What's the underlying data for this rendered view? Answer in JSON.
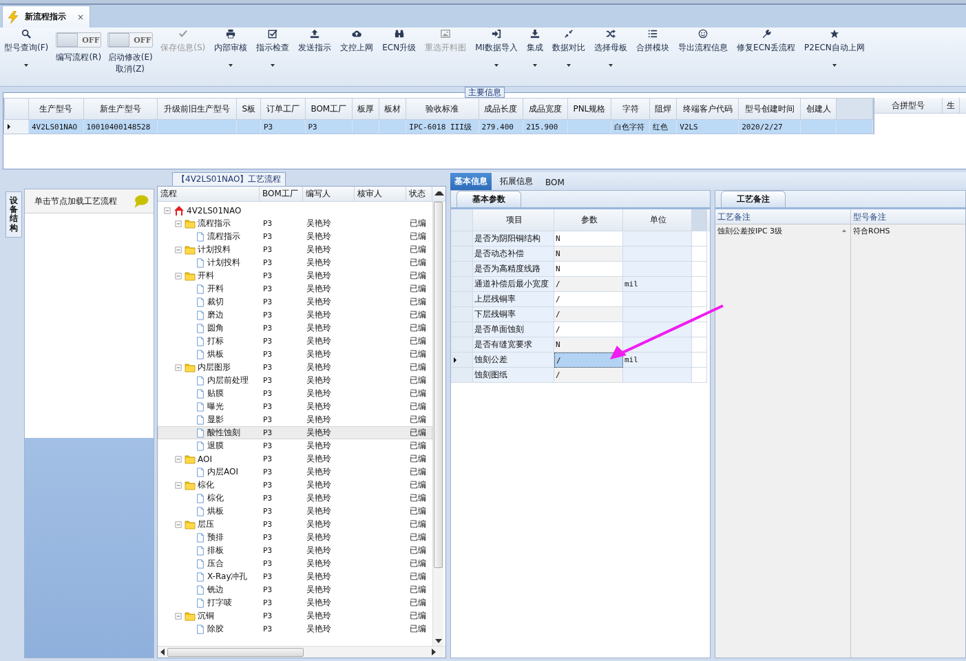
{
  "window": {
    "tab": {
      "title": "新流程指示",
      "selected": true
    },
    "close": "×"
  },
  "toolbar": {
    "items": [
      {
        "kind": "button",
        "label": "型号查询(F)",
        "dropdown": true,
        "disabled": false
      },
      {
        "kind": "toggle",
        "label": "编写流程(R)",
        "switch_text": "OFF",
        "on": false
      },
      {
        "kind": "toggle",
        "label": "启动修改(E)\n取消(Z)",
        "switch_text": "OFF",
        "on": false
      },
      {
        "kind": "button",
        "label": "保存信息(S)",
        "dropdown": false,
        "disabled": true
      },
      {
        "kind": "button",
        "label": "内部审核",
        "dropdown": true,
        "disabled": false
      },
      {
        "kind": "button",
        "label": "指示检查",
        "dropdown": true,
        "disabled": false
      },
      {
        "kind": "button",
        "label": "发送指示",
        "dropdown": false,
        "disabled": false
      },
      {
        "kind": "button",
        "label": "文控上网",
        "dropdown": false,
        "disabled": false
      },
      {
        "kind": "button",
        "label": "ECN升级",
        "dropdown": false,
        "disabled": false
      },
      {
        "kind": "button",
        "label": "重选开料图",
        "dropdown": false,
        "disabled": true
      },
      {
        "kind": "button",
        "label": "MI数据导入",
        "dropdown": true,
        "disabled": false
      },
      {
        "kind": "button",
        "label": "集成",
        "dropdown": true,
        "disabled": false
      },
      {
        "kind": "button",
        "label": "数据对比",
        "dropdown": true,
        "disabled": false
      },
      {
        "kind": "button",
        "label": "选择母板",
        "dropdown": true,
        "disabled": false
      },
      {
        "kind": "button",
        "label": "合拼模块",
        "dropdown": false,
        "disabled": false
      },
      {
        "kind": "button",
        "label": "导出流程信息",
        "dropdown": false,
        "disabled": false
      },
      {
        "kind": "button",
        "label": "修复ECN丢流程",
        "dropdown": false,
        "disabled": false
      },
      {
        "kind": "button",
        "label": "P2ECN自动上网",
        "dropdown": true,
        "disabled": false
      }
    ]
  },
  "main_info": {
    "title": "主要信息",
    "columns": [
      "生产型号",
      "新生产型号",
      "升级前旧生产型号",
      "S板",
      "订单工厂",
      "BOM工厂",
      "板厚",
      "板材",
      "验收标准",
      "成品长度",
      "成品宽度",
      "PNL规格",
      "字符",
      "阻焊",
      "终端客户代码",
      "型号创建时间",
      "创建人"
    ],
    "rows": [
      {
        "selected": true,
        "cells": [
          "4V2LS01NAO",
          "10010400148528",
          null,
          null,
          "P3",
          "P3",
          null,
          null,
          "IPC-6018 III级",
          "279.400",
          "215.900",
          null,
          "白色字符",
          "红色",
          "V2LS",
          "2020/2/27",
          null
        ]
      }
    ],
    "side_columns": [
      "合拼型号",
      "生"
    ]
  },
  "left_panel": {
    "side_tab": "设备结构",
    "hint": "单击节点加载工艺流程"
  },
  "process": {
    "title": "【4V2LS01NAO】工艺流程",
    "columns": [
      "流程",
      "BOM工厂",
      "编写人",
      "核审人",
      "状态"
    ],
    "tree": [
      {
        "label": "4V2LS01NAO",
        "expanded": true,
        "selected": false,
        "children": [
          {
            "label": "流程指示",
            "bom": "P3",
            "writer": "吴艳玲",
            "status": "已编",
            "expanded": true,
            "selected": false,
            "children": [
              {
                "label": "流程指示",
                "bom": "P3",
                "writer": "吴艳玲",
                "status": "已编",
                "selected": false
              }
            ]
          },
          {
            "label": "计划投料",
            "bom": "P3",
            "writer": "吴艳玲",
            "status": "已编",
            "expanded": true,
            "selected": false,
            "children": [
              {
                "label": "计划投料",
                "bom": "P3",
                "writer": "吴艳玲",
                "status": "已编",
                "selected": false
              }
            ]
          },
          {
            "label": "开料",
            "bom": "P3",
            "writer": "吴艳玲",
            "status": "已编",
            "expanded": true,
            "selected": false,
            "children": [
              {
                "label": "开料",
                "bom": "P3",
                "writer": "吴艳玲",
                "status": "已编",
                "selected": false
              },
              {
                "label": "裁切",
                "bom": "P3",
                "writer": "吴艳玲",
                "status": "已编",
                "selected": false
              },
              {
                "label": "磨边",
                "bom": "P3",
                "writer": "吴艳玲",
                "status": "已编",
                "selected": false
              },
              {
                "label": "圆角",
                "bom": "P3",
                "writer": "吴艳玲",
                "status": "已编",
                "selected": false
              },
              {
                "label": "打标",
                "bom": "P3",
                "writer": "吴艳玲",
                "status": "已编",
                "selected": false
              },
              {
                "label": "烘板",
                "bom": "P3",
                "writer": "吴艳玲",
                "status": "已编",
                "selected": false
              }
            ]
          },
          {
            "label": "内层图形",
            "bom": "P3",
            "writer": "吴艳玲",
            "status": "已编",
            "expanded": true,
            "selected": false,
            "children": [
              {
                "label": "内层前处理",
                "bom": "P3",
                "writer": "吴艳玲",
                "status": "已编",
                "selected": false
              },
              {
                "label": "贴膜",
                "bom": "P3",
                "writer": "吴艳玲",
                "status": "已编",
                "selected": false
              },
              {
                "label": "曝光",
                "bom": "P3",
                "writer": "吴艳玲",
                "status": "已编",
                "selected": false
              },
              {
                "label": "显影",
                "bom": "P3",
                "writer": "吴艳玲",
                "status": "已编",
                "selected": false
              },
              {
                "label": "酸性蚀刻",
                "bom": "P3",
                "writer": "吴艳玲",
                "status": "已编",
                "selected": true
              },
              {
                "label": "退膜",
                "bom": "P3",
                "writer": "吴艳玲",
                "status": "已编",
                "selected": false
              }
            ]
          },
          {
            "label": "AOI",
            "bom": "P3",
            "writer": "吴艳玲",
            "status": "已编",
            "expanded": true,
            "selected": false,
            "children": [
              {
                "label": "内层AOI",
                "bom": "P3",
                "writer": "吴艳玲",
                "status": "已编",
                "selected": false
              }
            ]
          },
          {
            "label": "棕化",
            "bom": "P3",
            "writer": "吴艳玲",
            "status": "已编",
            "expanded": true,
            "selected": false,
            "children": [
              {
                "label": "棕化",
                "bom": "P3",
                "writer": "吴艳玲",
                "status": "已编",
                "selected": false
              },
              {
                "label": "烘板",
                "bom": "P3",
                "writer": "吴艳玲",
                "status": "已编",
                "selected": false
              }
            ]
          },
          {
            "label": "层压",
            "bom": "P3",
            "writer": "吴艳玲",
            "status": "已编",
            "expanded": true,
            "selected": false,
            "children": [
              {
                "label": "预排",
                "bom": "P3",
                "writer": "吴艳玲",
                "status": "已编",
                "selected": false
              },
              {
                "label": "排板",
                "bom": "P3",
                "writer": "吴艳玲",
                "status": "已编",
                "selected": false
              },
              {
                "label": "压合",
                "bom": "P3",
                "writer": "吴艳玲",
                "status": "已编",
                "selected": false
              },
              {
                "label": "X-Ray冲孔",
                "bom": "P3",
                "writer": "吴艳玲",
                "status": "已编",
                "selected": false
              },
              {
                "label": "铣边",
                "bom": "P3",
                "writer": "吴艳玲",
                "status": "已编",
                "selected": false
              },
              {
                "label": "打字唛",
                "bom": "P3",
                "writer": "吴艳玲",
                "status": "已编",
                "selected": false
              }
            ]
          },
          {
            "label": "沉铜",
            "bom": "P3",
            "writer": "吴艳玲",
            "status": "已编",
            "expanded": true,
            "selected": false,
            "children": [
              {
                "label": "除胶",
                "bom": "P3",
                "writer": "吴艳玲",
                "status": "已编",
                "selected": false
              }
            ]
          }
        ]
      }
    ]
  },
  "detail": {
    "tabs": [
      {
        "label": "基本信息",
        "selected": true
      },
      {
        "label": "拓展信息",
        "selected": false
      },
      {
        "label": "BOM",
        "selected": false
      }
    ],
    "params": {
      "title": "基本参数",
      "columns": [
        "项目",
        "参数",
        "单位"
      ],
      "rows": [
        {
          "item": "是否为阴阳铜结构",
          "param": "N",
          "selected": false
        },
        {
          "item": "是否动态补偿",
          "param": "N",
          "selected": false
        },
        {
          "item": "是否为高精度线路",
          "param": "N",
          "selected": false
        },
        {
          "item": "通道补偿后最小宽度",
          "param": "/",
          "unit": "mil",
          "selected": false
        },
        {
          "item": "上层残铜率",
          "param": "/",
          "selected": false
        },
        {
          "item": "下层残铜率",
          "param": "/",
          "selected": false
        },
        {
          "item": "是否单面蚀刻",
          "param": "/",
          "selected": false
        },
        {
          "item": "是否有缝宽要求",
          "param": "N",
          "selected": false
        },
        {
          "item": "蚀刻公差",
          "param": "/",
          "unit": "mil",
          "selected": true
        },
        {
          "item": "蚀刻图纸",
          "param": "/",
          "selected": false
        }
      ]
    },
    "remarks": {
      "title": "工艺备注",
      "columns": [
        "工艺备注",
        "型号备注"
      ],
      "values": [
        "蚀刻公差按IPC 3级",
        "符合ROHS"
      ]
    }
  }
}
